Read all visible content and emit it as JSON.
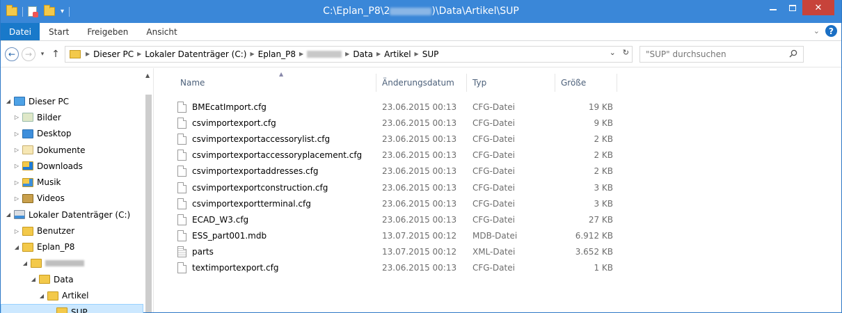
{
  "window": {
    "title_prefix": "C:\\Eplan_P8\\2",
    "title_suffix": ")\\Data\\Artikel\\SUP",
    "minimize": "–",
    "maximize": "□",
    "close": "✕"
  },
  "ribbon": {
    "tabs": [
      "Datei",
      "Start",
      "Freigeben",
      "Ansicht"
    ],
    "collapse": "⌄",
    "help": "?"
  },
  "navigation": {
    "back": "←",
    "forward": "→",
    "recent": "▾",
    "up": "↑",
    "breadcrumb": [
      "Dieser PC",
      "Lokaler Datenträger (C:)",
      "Eplan_P8",
      "Data",
      "Artikel",
      "SUP"
    ],
    "dropdown": "⌄",
    "refresh": "↻",
    "search_placeholder": "\"SUP\" durchsuchen"
  },
  "tree": [
    {
      "label": "Dieser PC",
      "icon": "pc-icon",
      "expander": "◢"
    },
    {
      "label": "Bilder",
      "icon": "pictures-folder-icon",
      "expander": "▷"
    },
    {
      "label": "Desktop",
      "icon": "desktop-folder-icon",
      "expander": "▷"
    },
    {
      "label": "Dokumente",
      "icon": "documents-folder-icon",
      "expander": "▷"
    },
    {
      "label": "Downloads",
      "icon": "downloads-folder-icon",
      "expander": "▷"
    },
    {
      "label": "Musik",
      "icon": "music-folder-icon",
      "expander": "▷"
    },
    {
      "label": "Videos",
      "icon": "videos-folder-icon",
      "expander": "▷"
    },
    {
      "label": "Lokaler Datenträger (C:)",
      "icon": "drive-icon",
      "expander": "◢"
    },
    {
      "label": "Benutzer",
      "icon": "folder-icon",
      "expander": "▷"
    },
    {
      "label": "Eplan_P8",
      "icon": "folder-icon",
      "expander": "◢"
    },
    {
      "label": "",
      "icon": "folder-icon",
      "expander": "◢"
    },
    {
      "label": "Data",
      "icon": "folder-icon",
      "expander": "◢"
    },
    {
      "label": "Artikel",
      "icon": "folder-icon",
      "expander": "◢"
    },
    {
      "label": "SUP",
      "icon": "folder-icon",
      "expander": ""
    }
  ],
  "columns": {
    "name": "Name",
    "date": "Änderungsdatum",
    "type": "Typ",
    "size": "Größe"
  },
  "files": [
    {
      "name": "BMEcatImport.cfg",
      "date": "23.06.2015 00:13",
      "type": "CFG-Datei",
      "size": "19 KB",
      "icon": "file-icon"
    },
    {
      "name": "csvimportexport.cfg",
      "date": "23.06.2015 00:13",
      "type": "CFG-Datei",
      "size": "9 KB",
      "icon": "file-icon"
    },
    {
      "name": "csvimportexportaccessorylist.cfg",
      "date": "23.06.2015 00:13",
      "type": "CFG-Datei",
      "size": "2 KB",
      "icon": "file-icon"
    },
    {
      "name": "csvimportexportaccessoryplacement.cfg",
      "date": "23.06.2015 00:13",
      "type": "CFG-Datei",
      "size": "2 KB",
      "icon": "file-icon"
    },
    {
      "name": "csvimportexportaddresses.cfg",
      "date": "23.06.2015 00:13",
      "type": "CFG-Datei",
      "size": "2 KB",
      "icon": "file-icon"
    },
    {
      "name": "csvimportexportconstruction.cfg",
      "date": "23.06.2015 00:13",
      "type": "CFG-Datei",
      "size": "3 KB",
      "icon": "file-icon"
    },
    {
      "name": "csvimportexportterminal.cfg",
      "date": "23.06.2015 00:13",
      "type": "CFG-Datei",
      "size": "3 KB",
      "icon": "file-icon"
    },
    {
      "name": "ECAD_W3.cfg",
      "date": "23.06.2015 00:13",
      "type": "CFG-Datei",
      "size": "27 KB",
      "icon": "file-icon"
    },
    {
      "name": "ESS_part001.mdb",
      "date": "13.07.2015 00:12",
      "type": "MDB-Datei",
      "size": "6.912 KB",
      "icon": "file-icon"
    },
    {
      "name": "parts",
      "date": "13.07.2015 00:12",
      "type": "XML-Datei",
      "size": "3.652 KB",
      "icon": "xml-file-icon"
    },
    {
      "name": "textimportexport.cfg",
      "date": "23.06.2015 00:13",
      "type": "CFG-Datei",
      "size": "1 KB",
      "icon": "file-icon"
    }
  ],
  "colors": {
    "titlebar": "#3a87d8",
    "file_tab": "#1979ca",
    "close_button": "#c7433a",
    "selection": "#cce8ff"
  }
}
